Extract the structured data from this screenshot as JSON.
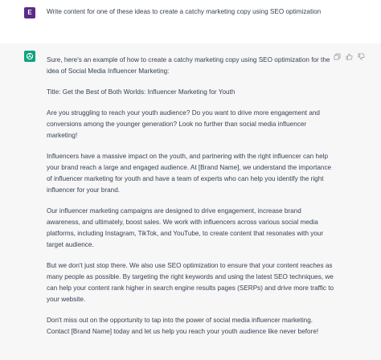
{
  "user_message": {
    "avatar_letter": "E",
    "text": "Write content for one of these ideas to create a catchy marketing copy using SEO optimization"
  },
  "assistant_message": {
    "paragraphs": [
      "Sure, here's an example of how to create a catchy marketing copy using SEO optimization for the idea of Social Media Influencer Marketing:",
      "Title: Get the Best of Both Worlds: Influencer Marketing for Youth",
      "Are you struggling to reach your youth audience? Do you want to drive more engagement and conversions among the younger generation? Look no further than social media influencer marketing!",
      "Influencers have a massive impact on the youth, and partnering with the right influencer can help your brand reach a large and engaged audience. At [Brand Name], we understand the importance of influencer marketing for youth and have a team of experts who can help you identify the right influencer for your brand.",
      "Our influencer marketing campaigns are designed to drive engagement, increase brand awareness, and ultimately, boost sales. We work with influencers across various social media platforms, including Instagram, TikTok, and YouTube, to create content that resonates with your target audience.",
      "But we don't just stop there. We also use SEO optimization to ensure that your content reaches as many people as possible. By targeting the right keywords and using the latest SEO techniques, we can help your content rank higher in search engine results pages (SERPs) and drive more traffic to your website.",
      "Don't miss out on the opportunity to tap into the power of social media influencer marketing. Contact [Brand Name] today and let us help you reach your youth audience like never before!"
    ]
  },
  "colors": {
    "user_avatar": "#5b2a86",
    "assistant_avatar": "#10a37f",
    "assistant_bg": "#f7f7f8"
  },
  "icons": [
    "copy-icon",
    "thumbs-up-icon",
    "thumbs-down-icon",
    "openai-logo-icon"
  ]
}
